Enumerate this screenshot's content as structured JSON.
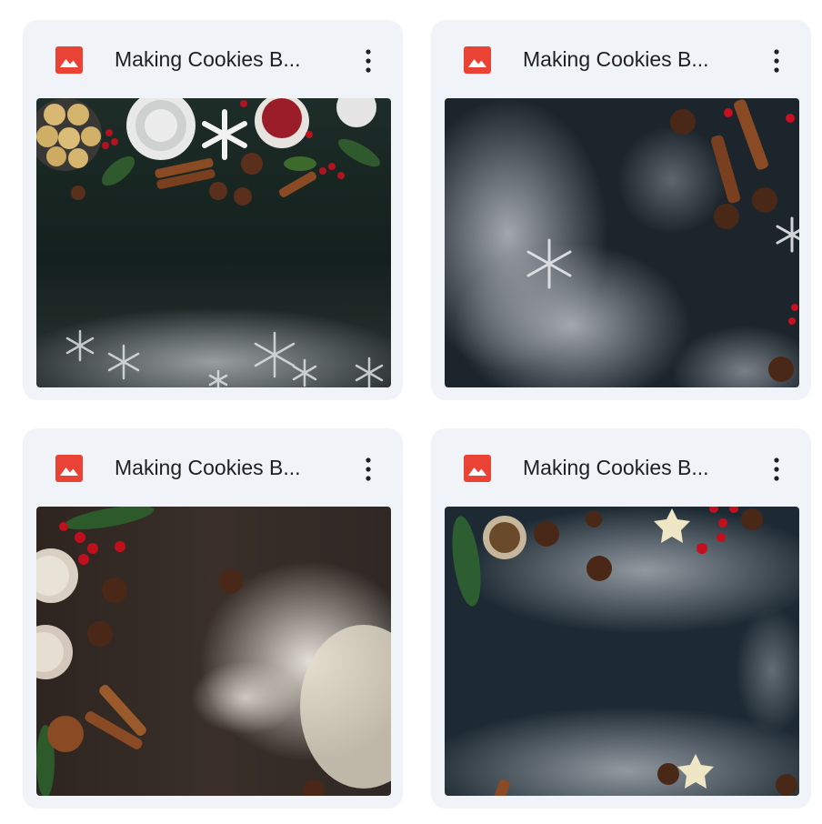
{
  "files": [
    {
      "title": "Making Cookies B...",
      "icon": "image-file-icon",
      "menu_icon": "more-vert-icon"
    },
    {
      "title": "Making Cookies B...",
      "icon": "image-file-icon",
      "menu_icon": "more-vert-icon"
    },
    {
      "title": "Making Cookies B...",
      "icon": "image-file-icon",
      "menu_icon": "more-vert-icon"
    },
    {
      "title": "Making Cookies B...",
      "icon": "image-file-icon",
      "menu_icon": "more-vert-icon"
    }
  ],
  "colors": {
    "card_bg": "#f0f4f9",
    "image_icon_red": "#ea4335",
    "title_text": "#1f1f1f"
  }
}
